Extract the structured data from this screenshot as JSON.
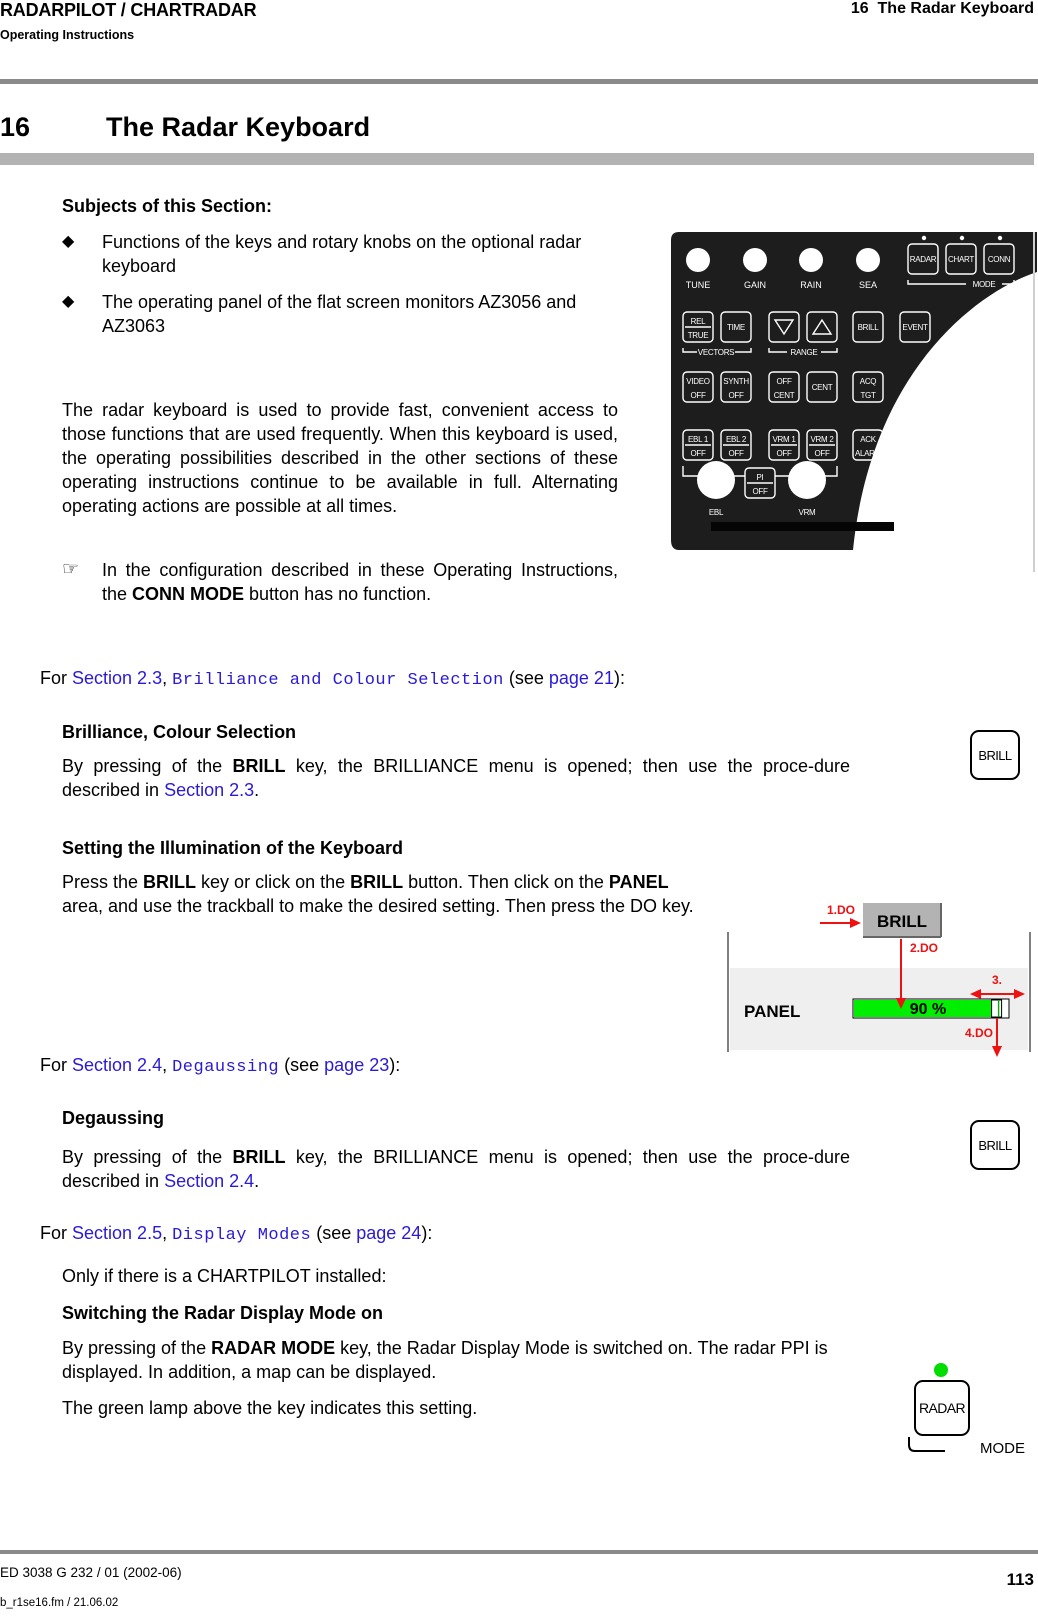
{
  "header": {
    "product": "RADARPILOT / CHARTRADAR",
    "subtitle": "Operating Instructions",
    "chapter_ref": "16  The Radar Keyboard"
  },
  "chapter": {
    "number": "16",
    "title": "The Radar Keyboard"
  },
  "subjects": {
    "heading": "Subjects of this Section:",
    "bullet_icon": "diamond-bullet-icon",
    "items": [
      "Functions of the keys and rotary knobs on the optional radar keyboard",
      "The operating panel of the flat screen monitors AZ3056 and AZ3063"
    ]
  },
  "intro": {
    "paragraph": "The radar keyboard is used to provide fast, convenient access to those functions that are used frequently. When this keyboard is used, the operating possibilities described in the other sections of these operating instructions continue to be available in full. Alternating operating actions are possible at all times.",
    "note_icon": "pointing-hand-icon",
    "note_pre": "In the configuration described in these Operating Instructions, the ",
    "note_bold": "CONN MODE",
    "note_post": " button has no function."
  },
  "keyboard": {
    "knobs_top": [
      "TUNE",
      "GAIN",
      "RAIN",
      "SEA"
    ],
    "mode_keys": [
      "RADAR",
      "CHART",
      "CONN"
    ],
    "mode_label": "MODE",
    "row2": {
      "rel_true": [
        "REL",
        "TRUE"
      ],
      "time": "TIME",
      "vectors_label": "VECTORS",
      "range_down": "▽",
      "range_up": "△",
      "range_label": "RANGE",
      "brill": "BRILL",
      "event": "EVENT"
    },
    "row3": {
      "video_off": [
        "VIDEO",
        "OFF"
      ],
      "synth_off": [
        "SYNTH",
        "OFF"
      ],
      "off_cent": [
        "OFF",
        "CENT"
      ],
      "cent": "CENT",
      "acq_tgt": [
        "ACQ",
        "TGT"
      ]
    },
    "row4": {
      "ebl1": [
        "EBL 1",
        "OFF"
      ],
      "ebl2": [
        "EBL 2",
        "OFF"
      ],
      "vrm1": [
        "VRM 1",
        "OFF"
      ],
      "vrm2": [
        "VRM 2",
        "OFF"
      ],
      "ack_alarm": [
        "ACK",
        "ALARM"
      ]
    },
    "pi_off": [
      "PI",
      "OFF"
    ],
    "knobs_bottom": [
      "EBL",
      "VRM"
    ]
  },
  "sections": [
    {
      "for_prefix": "For ",
      "section_link": "Section 2.3",
      "sep": ", ",
      "title_link": "Brilliance and Colour Selection",
      "see": " (see ",
      "page_link": "page 21",
      "end": "):",
      "blocks": [
        {
          "heading": "Brilliance, Colour Selection",
          "text_pre": "By pressing of the ",
          "text_bold": "BRILL",
          "text_mid": " key, the BRILLIANCE menu is opened; then use the proce-dure described in ",
          "text_link": "Section 2.3",
          "text_end": ".",
          "key_icon": "BRILL"
        },
        {
          "heading": "Setting the Illumination of the Keyboard",
          "p1": "Press the ",
          "b1": "BRILL",
          "p2": " key or click on the ",
          "b2": "BRILL",
          "p3": " button. Then click on the ",
          "b3": "PANEL",
          "p4": " area, and use the trackball to make the desired setting. Then press the DO key."
        }
      ]
    },
    {
      "for_prefix": "For ",
      "section_link": "Section 2.4",
      "sep": ", ",
      "title_link": "Degaussing",
      "see": " (see ",
      "page_link": "page 23",
      "end": "):",
      "blocks": [
        {
          "heading": "Degaussing",
          "text_pre": "By pressing of the ",
          "text_bold": "BRILL",
          "text_mid": " key, the BRILLIANCE menu is opened; then use the proce-dure described in ",
          "text_link": "Section 2.4",
          "text_end": ".",
          "key_icon": "BRILL"
        }
      ]
    },
    {
      "for_prefix": "For ",
      "section_link": "Section 2.5",
      "sep": ", ",
      "title_link": "Display Modes",
      "see": " (see ",
      "page_link": "page 24",
      "end": "):",
      "blocks": [
        {
          "intro": "Only if there is a CHARTPILOT installed:",
          "heading": "Switching the Radar Display Mode on",
          "p1": "By pressing of the ",
          "b1": "RADAR MODE",
          "p2": " key, the Radar Display Mode is switched on. The radar PPI is displayed. In addition, a map can be displayed.",
          "p3": "The green lamp above the key indicates this setting.",
          "key_label": "RADAR",
          "mode_label": "MODE"
        }
      ]
    }
  ],
  "brill_diagram": {
    "button_label": "BRILL",
    "panel_label": "PANEL",
    "value_text": "90 %",
    "value_percent": 90,
    "steps": [
      "1.DO",
      "2.DO",
      "3.",
      "4.DO"
    ]
  },
  "colors": {
    "link": "#2a1ad6",
    "annotation_red": "#ee1111",
    "bar_green": "#00ee00",
    "lamp_green": "#00dd00"
  },
  "footer": {
    "doc_id": "ED 3038 G 232 / 01 (2002-06)",
    "file": "b_r1se16.fm / 21.06.02",
    "page_number": "113"
  }
}
